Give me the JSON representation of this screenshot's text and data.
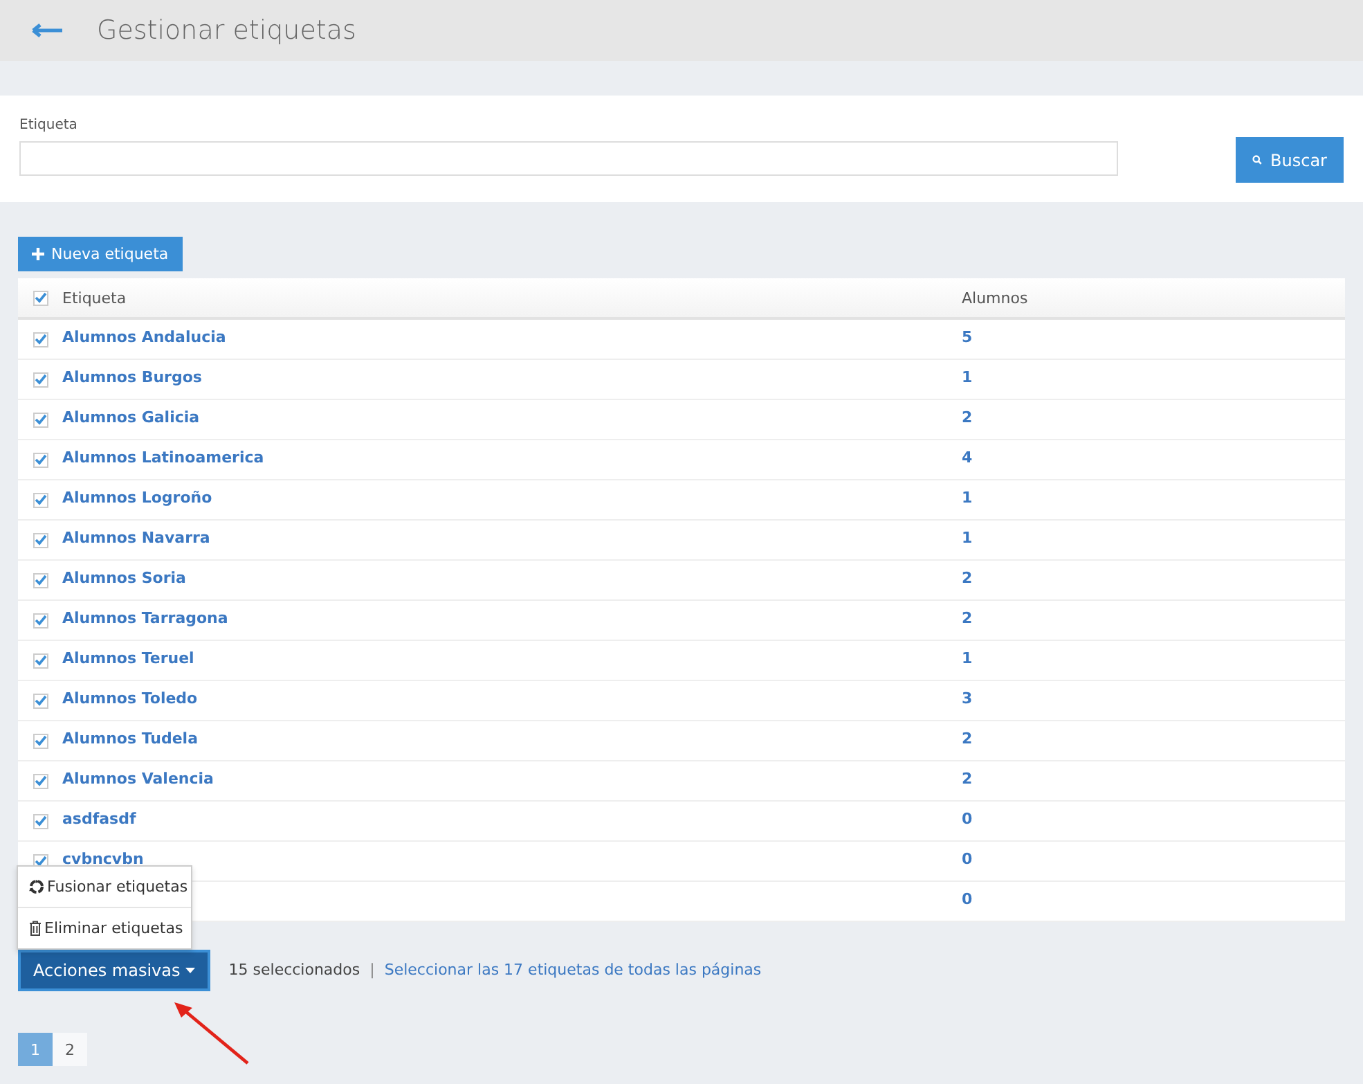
{
  "header": {
    "title": "Gestionar etiquetas"
  },
  "search": {
    "label": "Etiqueta",
    "button": "Buscar"
  },
  "new_button": "Nueva etiqueta",
  "table": {
    "columns": [
      "Etiqueta",
      "Alumnos"
    ],
    "all_checked": true,
    "rows": [
      {
        "name": "Alumnos Andalucia",
        "count": "5",
        "checked": true
      },
      {
        "name": "Alumnos Burgos",
        "count": "1",
        "checked": true
      },
      {
        "name": "Alumnos Galicia",
        "count": "2",
        "checked": true
      },
      {
        "name": "Alumnos Latinoamerica",
        "count": "4",
        "checked": true
      },
      {
        "name": "Alumnos Logroño",
        "count": "1",
        "checked": true
      },
      {
        "name": "Alumnos Navarra",
        "count": "1",
        "checked": true
      },
      {
        "name": "Alumnos Soria",
        "count": "2",
        "checked": true
      },
      {
        "name": "Alumnos Tarragona",
        "count": "2",
        "checked": true
      },
      {
        "name": "Alumnos Teruel",
        "count": "1",
        "checked": true
      },
      {
        "name": "Alumnos Toledo",
        "count": "3",
        "checked": true
      },
      {
        "name": "Alumnos Tudela",
        "count": "2",
        "checked": true
      },
      {
        "name": "Alumnos Valencia",
        "count": "2",
        "checked": true
      },
      {
        "name": "asdfasdf",
        "count": "0",
        "checked": true
      },
      {
        "name": "cvbncvbn",
        "count": "0",
        "checked": true
      },
      {
        "count": "0"
      }
    ]
  },
  "bulk_menu": {
    "items": [
      {
        "kind": "merge",
        "label": "Fusionar etiquetas"
      },
      {
        "kind": "delete",
        "label": "Eliminar etiquetas"
      }
    ]
  },
  "bulk_button": "Acciones masivas",
  "selection": {
    "count_text": "15 seleccionados",
    "separator": "|",
    "link": "Seleccionar las 17 etiquetas de todas las páginas"
  },
  "pagination": [
    {
      "label": "1",
      "selected": true
    },
    {
      "label": "2",
      "selected": false
    }
  ]
}
